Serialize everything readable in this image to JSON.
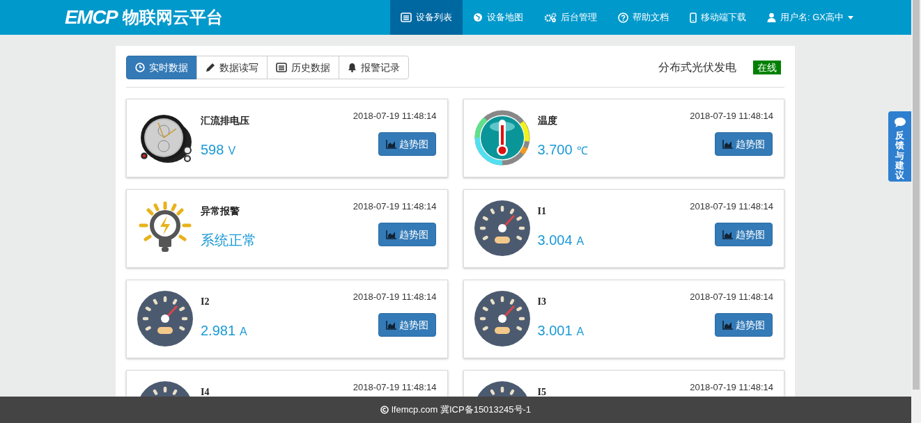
{
  "brand": {
    "logo": "EMCP",
    "title": "物联网云平台"
  },
  "nav": [
    {
      "label": "设备列表",
      "kind": "list",
      "selected": true
    },
    {
      "label": "设备地图",
      "kind": "globe",
      "selected": false
    },
    {
      "label": "后台管理",
      "kind": "gears",
      "selected": false
    },
    {
      "label": "帮助文档",
      "kind": "question",
      "selected": false
    },
    {
      "label": "移动端下载",
      "kind": "phone",
      "selected": false
    },
    {
      "label": "用户名: GX高中",
      "kind": "user",
      "selected": false
    }
  ],
  "tabs": [
    {
      "label": "实时数据",
      "kind": "clock",
      "selected": true
    },
    {
      "label": "数据读写",
      "kind": "pencil",
      "selected": false
    },
    {
      "label": "历史数据",
      "kind": "list",
      "selected": false
    },
    {
      "label": "报警记录",
      "kind": "bell",
      "selected": false
    }
  ],
  "device": {
    "name": "分布式光伏发电",
    "status": "在线"
  },
  "cards": [
    {
      "kind": "stopwatch",
      "title": "汇流排电压",
      "time": "2018-07-19 11:48:14",
      "value": "598",
      "unit": "V",
      "button": "趋势图"
    },
    {
      "kind": "thermometer",
      "title": "温度",
      "time": "2018-07-19 11:48:14",
      "value": "3.700",
      "unit": "℃",
      "button": "趋势图"
    },
    {
      "kind": "bulb",
      "title": "异常报警",
      "time": "2018-07-19 11:48:14",
      "value": "系统正常",
      "button": "趋势图"
    },
    {
      "kind": "gauge",
      "title": "I1",
      "time": "2018-07-19 11:48:14",
      "value": "3.004",
      "unit": "A",
      "button": "趋势图"
    },
    {
      "kind": "gauge",
      "title": "I2",
      "time": "2018-07-19 11:48:14",
      "value": "2.981",
      "unit": "A",
      "button": "趋势图"
    },
    {
      "kind": "gauge",
      "title": "I3",
      "time": "2018-07-19 11:48:14",
      "value": "3.001",
      "unit": "A",
      "button": "趋势图"
    },
    {
      "kind": "gauge",
      "title": "I4",
      "time": "2018-07-19 11:48:14"
    },
    {
      "kind": "gauge",
      "title": "I5",
      "time": "2018-07-19 11:48:14"
    }
  ],
  "feedback": "反馈与建议",
  "footer": "lfemcp.com 冀ICP备15013245号-1"
}
